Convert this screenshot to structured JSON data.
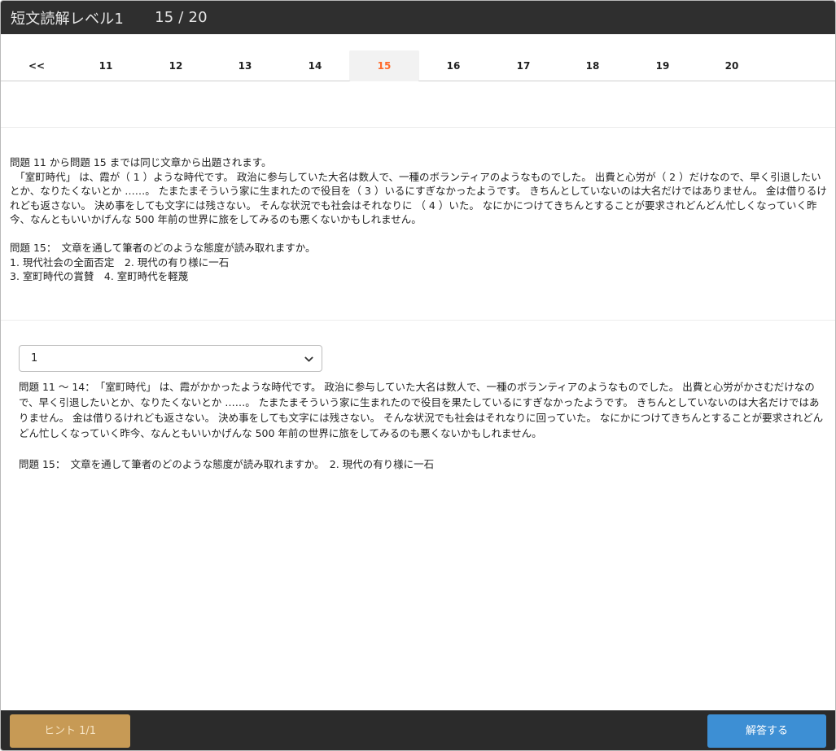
{
  "header": {
    "title": "短文読解レベル1",
    "progress": "15 / 20"
  },
  "pager": {
    "items": [
      "<<",
      "11",
      "12",
      "13",
      "14",
      "15",
      "16",
      "17",
      "18",
      "19",
      "20"
    ],
    "active": "15",
    "accent_color": "#ff6a2b"
  },
  "question": {
    "intro": "問題 11 から問題 15 までは同じ文章から出題されます。",
    "passage": "　「室町時代」 は、霞が（ 1 ）ような時代です。 政治に参与していた大名は数人で、一種のボランティアのようなものでした。 出費と心労が（ 2 ）だけなので、早く引退したいとか、なりたくないとか ……。 たまたまそういう家に生まれたので役目を（ 3 ）いるにすぎなかったようです。 きちんとしていないのは大名だけではありません。 金は借りるけれども返さない。 決め事をしても文字には残さない。 そんな状況でも社会はそれなりに （ 4 ）いた。 なにかにつけてきちんとすることが要求されどんどん忙しくなっていく昨今、なんともいいかげんな 500 年前の世界に旅をしてみるのも悪くないかもしれません。",
    "prompt": "問題 15：　文章を通して筆者のどのような態度が読み取れますか。",
    "options_line1": "1. 現代社会の全面否定　2. 現代の有り様に一石",
    "options_line2": "3. 室町時代の賞賛　4. 室町時代を軽蔑"
  },
  "answer_select": {
    "value": "1",
    "icon": "chevron-down-icon"
  },
  "explanation": {
    "part1": "問題 11 ～ 14：　「室町時代」 は、霞がかかったような時代です。 政治に参与していた大名は数人で、一種のボランティアのようなものでした。 出費と心労がかさむだけなので、早く引退したいとか、なりたくないとか ……。 たまたまそういう家に生まれたので役目を果たしているにすぎなかったようです。 きちんとしていないのは大名だけではありません。 金は借りるけれども返さない。 決め事をしても文字には残さない。 そんな状況でも社会はそれなりに回っていた。 なにかにつけてきちんとすることが要求されどんどん忙しくなっていく昨今、なんともいいかげんな 500 年前の世界に旅をしてみるのも悪くないかもしれません。",
    "part2": "問題 15：　文章を通して筆者のどのような態度が読み取れますか。　2. 現代の有り様に一石"
  },
  "footer": {
    "hint_label": "ヒント 1/1",
    "submit_label": "解答する",
    "hint_color": "#c79a55",
    "submit_color": "#3d8fd4"
  }
}
